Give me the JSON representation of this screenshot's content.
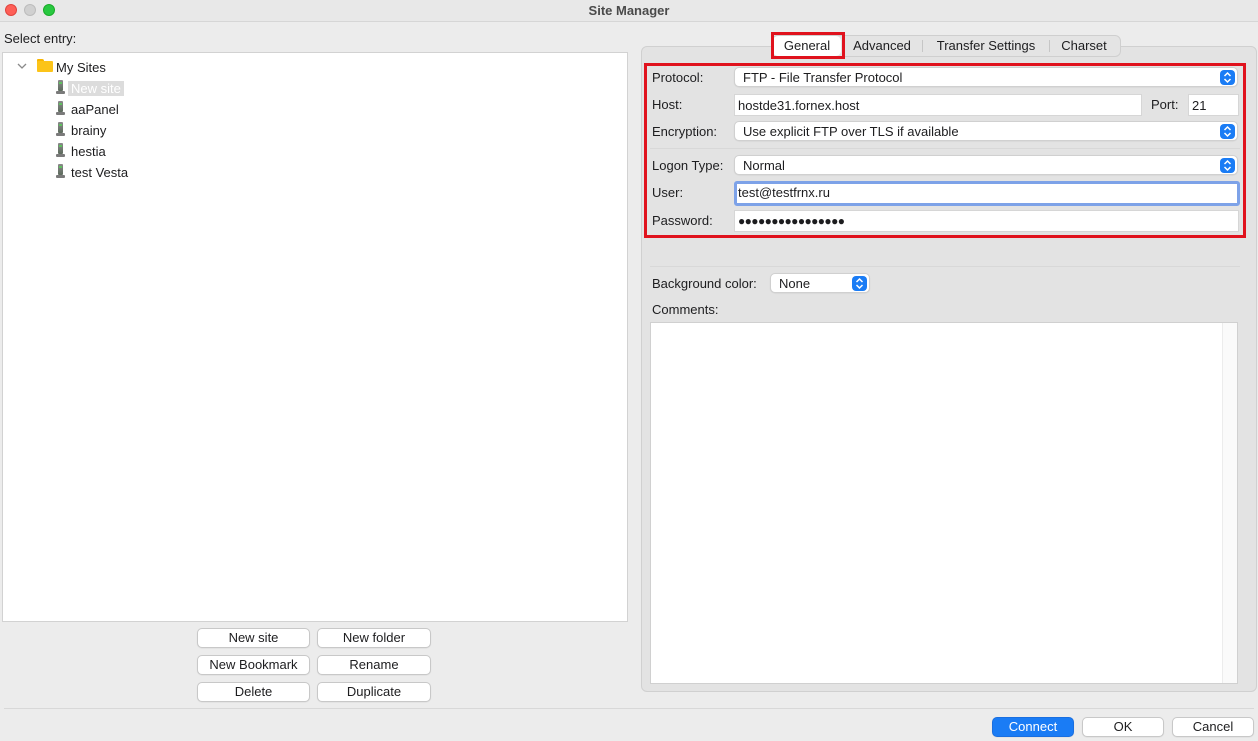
{
  "window": {
    "title": "Site Manager"
  },
  "left": {
    "select_label": "Select entry:",
    "tree": {
      "root": "My Sites",
      "sites": [
        "New site",
        "aaPanel",
        "brainy",
        "hestia",
        "test Vesta"
      ],
      "selected": "New site"
    },
    "buttons": {
      "new_site": "New site",
      "new_folder": "New folder",
      "new_bookmark": "New Bookmark",
      "rename": "Rename",
      "delete": "Delete",
      "duplicate": "Duplicate"
    }
  },
  "tabs": [
    "General",
    "Advanced",
    "Transfer Settings",
    "Charset"
  ],
  "active_tab": "General",
  "general": {
    "protocol_label": "Protocol:",
    "protocol_value": "FTP - File Transfer Protocol",
    "host_label": "Host:",
    "host_value": "hostde31.fornex.host",
    "port_label": "Port:",
    "port_value": "21",
    "encryption_label": "Encryption:",
    "encryption_value": "Use explicit FTP over TLS if available",
    "logon_type_label": "Logon Type:",
    "logon_type_value": "Normal",
    "user_label": "User:",
    "user_value": "test@testfrnx.ru",
    "password_label": "Password:",
    "password_value": "●●●●●●●●●●●●●●●●",
    "background_color_label": "Background color:",
    "background_color_value": "None",
    "comments_label": "Comments:"
  },
  "footer": {
    "connect": "Connect",
    "ok": "OK",
    "cancel": "Cancel"
  },
  "colors": {
    "accent": "#1a7cf5",
    "highlight": "#e0121d"
  }
}
